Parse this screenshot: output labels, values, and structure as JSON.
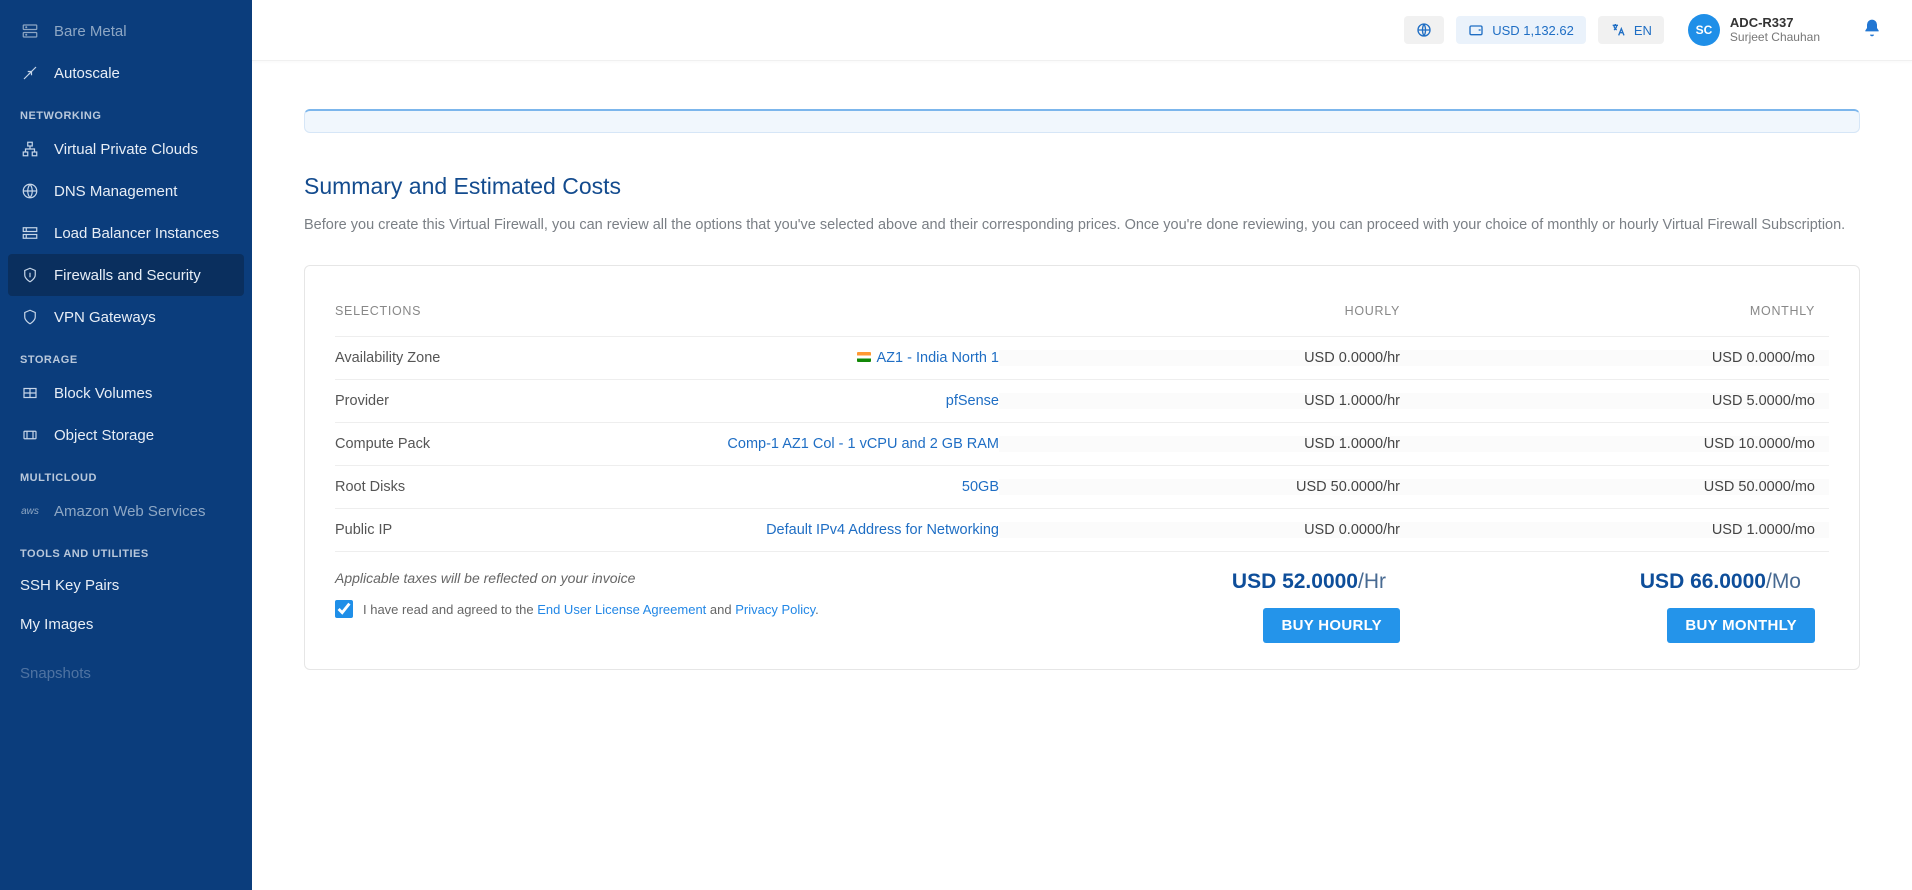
{
  "topbar": {
    "balance": "USD 1,132.62",
    "lang": "EN",
    "user_initials": "SC",
    "user_id": "ADC-R337",
    "user_name": "Surjeet Chauhan"
  },
  "sidebar": {
    "items_top": [
      {
        "label": "Bare Metal",
        "icon": "server",
        "dim": true
      },
      {
        "label": "Autoscale",
        "icon": "scale",
        "dim": false
      }
    ],
    "section_networking": "NETWORKING",
    "items_networking": [
      {
        "label": "Virtual Private Clouds",
        "icon": "vpc"
      },
      {
        "label": "DNS Management",
        "icon": "globe"
      },
      {
        "label": "Load Balancer Instances",
        "icon": "lb"
      },
      {
        "label": "Firewalls and Security",
        "icon": "firewall",
        "active": true
      },
      {
        "label": "VPN Gateways",
        "icon": "shield"
      }
    ],
    "section_storage": "STORAGE",
    "items_storage": [
      {
        "label": "Block Volumes",
        "icon": "block"
      },
      {
        "label": "Object Storage",
        "icon": "object"
      }
    ],
    "section_multicloud": "MULTICLOUD",
    "items_multicloud": [
      {
        "label": "Amazon Web Services",
        "icon": "aws",
        "dim": true
      }
    ],
    "section_tools": "TOOLS AND UTILITIES",
    "items_tools": [
      {
        "label": "SSH Key Pairs"
      },
      {
        "label": "My Images"
      },
      {
        "label": "Snapshots"
      }
    ]
  },
  "summary": {
    "title": "Summary and Estimated Costs",
    "desc": "Before you create this Virtual Firewall, you can review all the options that you've selected above and their corresponding prices. Once you're done reviewing, you can proceed with your choice of monthly or hourly Virtual Firewall Subscription.",
    "head_selections": "SELECTIONS",
    "head_hourly": "HOURLY",
    "head_monthly": "MONTHLY",
    "rows": [
      {
        "label": "Availability Zone",
        "value": "AZ1 - India North 1",
        "hourly": "USD 0.0000/hr",
        "monthly": "USD 0.0000/mo",
        "flag": true
      },
      {
        "label": "Provider",
        "value": "pfSense",
        "hourly": "USD 1.0000/hr",
        "monthly": "USD 5.0000/mo"
      },
      {
        "label": "Compute Pack",
        "value": "Comp-1 AZ1 Col - 1 vCPU and 2 GB RAM",
        "hourly": "USD 1.0000/hr",
        "monthly": "USD 10.0000/mo"
      },
      {
        "label": "Root Disks",
        "value": "50GB",
        "hourly": "USD 50.0000/hr",
        "monthly": "USD 50.0000/mo"
      },
      {
        "label": "Public IP",
        "value": "Default IPv4 Address for Networking",
        "hourly": "USD 0.0000/hr",
        "monthly": "USD 1.0000/mo"
      }
    ],
    "tax_note": "Applicable taxes will be reflected on your invoice",
    "agree_prefix": "I have read and agreed to the ",
    "eula": "End User License Agreement",
    "agree_mid": " and ",
    "privacy": "Privacy Policy",
    "agree_suffix": ".",
    "total_hourly_val": "USD 52.0000",
    "total_hourly_unit": "/Hr",
    "total_monthly_val": "USD 66.0000",
    "total_monthly_unit": "/Mo",
    "buy_hourly": "BUY HOURLY",
    "buy_monthly": "BUY MONTHLY"
  }
}
